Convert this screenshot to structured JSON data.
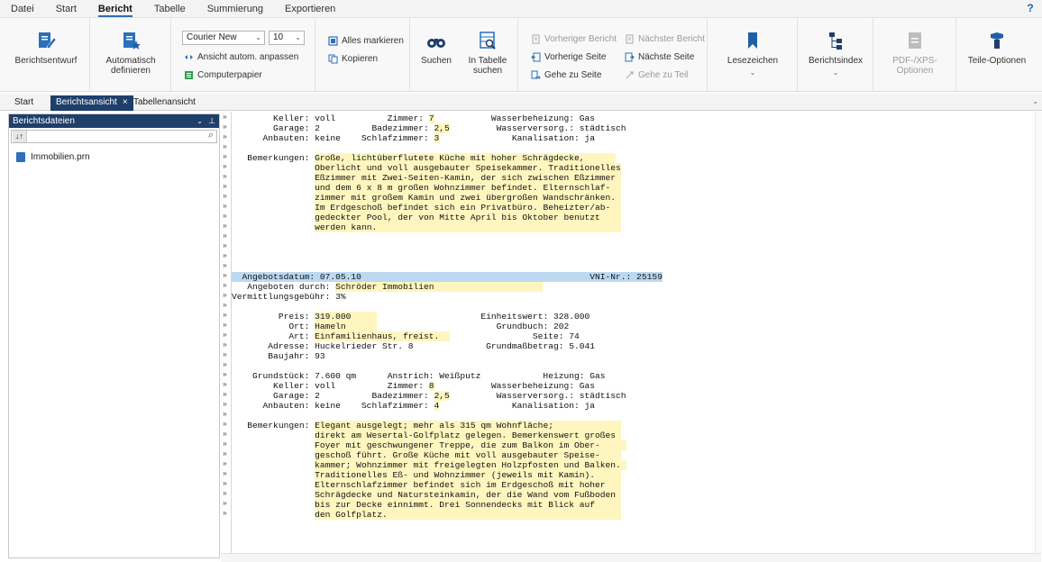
{
  "menu": {
    "items": [
      "Datei",
      "Start",
      "Bericht",
      "Tabelle",
      "Summierung",
      "Exportieren"
    ],
    "help": "?"
  },
  "ribbon": {
    "berichtsentwurf": "Berichtsentwurf",
    "automatisch": "Automatisch definieren",
    "font_value": "Courier New",
    "size_value": "10",
    "ansicht_anpassen": "Ansicht autom. anpassen",
    "computerpapier": "Computerpapier",
    "alles_markieren": "Alles markieren",
    "kopieren": "Kopieren",
    "suchen": "Suchen",
    "in_tabelle_suchen": "In Tabelle suchen",
    "vorheriger_bericht": "Vorheriger Bericht",
    "naechster_bericht": "Nächster Bericht",
    "vorherige_seite": "Vorherige Seite",
    "naechste_seite": "Nächste Seite",
    "gehe_zu_seite": "Gehe zu Seite",
    "gehe_zu_teil": "Gehe zu Teil",
    "lesezeichen": "Lesezeichen",
    "berichtsindex": "Berichtsindex",
    "pdf_optionen": "PDF-/XPS-Optionen",
    "teile_optionen": "Teile-Optionen"
  },
  "tabs": {
    "start": "Start",
    "berichtsansicht": "Berichtsansicht",
    "close": "×",
    "tabellenansicht": "Tabellenansicht"
  },
  "leftpanel": {
    "title": "Berichtsdateien",
    "sort": "↓↑",
    "file": "Immobilien.prn"
  },
  "report_lines": [
    {
      "prefix": "        Keller: voll          Zimmer: ",
      "hl": "7",
      "suffix": "           Wasserbeheizung: Gas"
    },
    {
      "prefix": "        Garage: 2          Badezimmer: ",
      "hl": "2,5",
      "suffix": "         Wasserversorg.: städtisch"
    },
    {
      "prefix": "      Anbauten: keine    Schlafzimmer: ",
      "hl": "3",
      "suffix": "              Kanalisation: ja"
    },
    {
      "prefix": "",
      "hl": "",
      "suffix": ""
    },
    {
      "prefix": "   Bemerkungen: ",
      "hl": "Große, lichtüberflutete Küche mit hoher Schrägdecke,      ",
      "suffix": ""
    },
    {
      "prefix": "                ",
      "hl": "Oberlicht und voll ausgebauter Speisekammer. Traditionelles",
      "suffix": ""
    },
    {
      "prefix": "                ",
      "hl": "Eßzimmer mit Zwei-Seiten-Kamin, der sich zwischen Eßzimmer ",
      "suffix": ""
    },
    {
      "prefix": "                ",
      "hl": "und dem 6 x 8 m großen Wohnzimmer befindet. Elternschlaf-  ",
      "suffix": ""
    },
    {
      "prefix": "                ",
      "hl": "zimmer mit großem Kamin und zwei übergroßen Wandschränken. ",
      "suffix": ""
    },
    {
      "prefix": "                ",
      "hl": "Im Erdgeschoß befindet sich ein Privatbüro. Beheizter/ab-  ",
      "suffix": ""
    },
    {
      "prefix": "                ",
      "hl": "gedeckter Pool, der von Mitte April bis Oktober benutzt    ",
      "suffix": ""
    },
    {
      "prefix": "                ",
      "hl": "werden kann.                                               ",
      "suffix": ""
    },
    {
      "prefix": "",
      "hl": "",
      "suffix": ""
    },
    {
      "prefix": "",
      "hl": "",
      "suffix": ""
    },
    {
      "prefix": "",
      "hl": "",
      "suffix": ""
    },
    {
      "prefix": "",
      "hl": "",
      "suffix": ""
    },
    {
      "prefix": "",
      "hl": "",
      "suffix": "",
      "blue": "  Angebotsdatum: 07.05.10                                            VNI-Nr.: 25159"
    },
    {
      "prefix": "   Angeboten durch: ",
      "hl": "Schröder Immobilien                     ",
      "suffix": ""
    },
    {
      "prefix": "Vermittlungsgebühr: 3%",
      "hl": "",
      "suffix": ""
    },
    {
      "prefix": "",
      "hl": "",
      "suffix": ""
    },
    {
      "prefix": "         Preis: ",
      "hl": "319.000     ",
      "suffix": "                    Einheitswert: 328.000"
    },
    {
      "prefix": "           Ort: ",
      "hl": "Hameln      ",
      "suffix": "                       Grundbuch: 202"
    },
    {
      "prefix": "           Art: ",
      "hl": "Einfamilienhaus, freist.  ",
      "suffix": "                Seite: 74"
    },
    {
      "prefix": "       Adresse: Huckelrieder Str. 8",
      "hl": "",
      "suffix": "              Grundmaßbetrag: 5.041"
    },
    {
      "prefix": "       Baujahr: 93",
      "hl": "",
      "suffix": ""
    },
    {
      "prefix": "",
      "hl": "",
      "suffix": ""
    },
    {
      "prefix": "    Grundstück: 7.600 qm      Anstrich: Weißputz            Heizung: Gas",
      "hl": "",
      "suffix": ""
    },
    {
      "prefix": "        Keller: voll          Zimmer: ",
      "hl": "8",
      "suffix": "           Wasserbeheizung: Gas"
    },
    {
      "prefix": "        Garage: 2          Badezimmer: ",
      "hl": "2,5",
      "suffix": "         Wasserversorg.: städtisch"
    },
    {
      "prefix": "      Anbauten: keine    Schlafzimmer: ",
      "hl": "4",
      "suffix": "              Kanalisation: ja"
    },
    {
      "prefix": "",
      "hl": "",
      "suffix": ""
    },
    {
      "prefix": "   Bemerkungen: ",
      "hl": "Elegant ausgelegt; mehr als 315 qm Wohnfläche;             ",
      "suffix": ""
    },
    {
      "prefix": "                ",
      "hl": "direkt am Wesertal-Golfplatz gelegen. Bemerkenswert großes ",
      "suffix": ""
    },
    {
      "prefix": "                ",
      "hl": "Foyer mit geschwungener Treppe, die zum Balkon im Ober-     ",
      "suffix": ""
    },
    {
      "prefix": "                ",
      "hl": "geschoß führt. Große Küche mit voll ausgebauter Speise-    ",
      "suffix": ""
    },
    {
      "prefix": "                ",
      "hl": "kammer; Wohnzimmer mit freigelegten Holzpfosten und Balken. ",
      "suffix": ""
    },
    {
      "prefix": "                ",
      "hl": "Traditionelles Eß- und Wohnzimmer (jeweils mit Kamin).     ",
      "suffix": ""
    },
    {
      "prefix": "                ",
      "hl": "Elternschlafzimmer befindet sich im Erdgeschoß mit hoher   ",
      "suffix": ""
    },
    {
      "prefix": "                ",
      "hl": "Schrägdecke und Natursteinkamin, der die Wand vom Fußboden ",
      "suffix": ""
    },
    {
      "prefix": "                ",
      "hl": "bis zur Decke einnimmt. Drei Sonnendecks mit Blick auf     ",
      "suffix": ""
    },
    {
      "prefix": "                ",
      "hl": "den Golfplatz.                                             ",
      "suffix": ""
    }
  ]
}
